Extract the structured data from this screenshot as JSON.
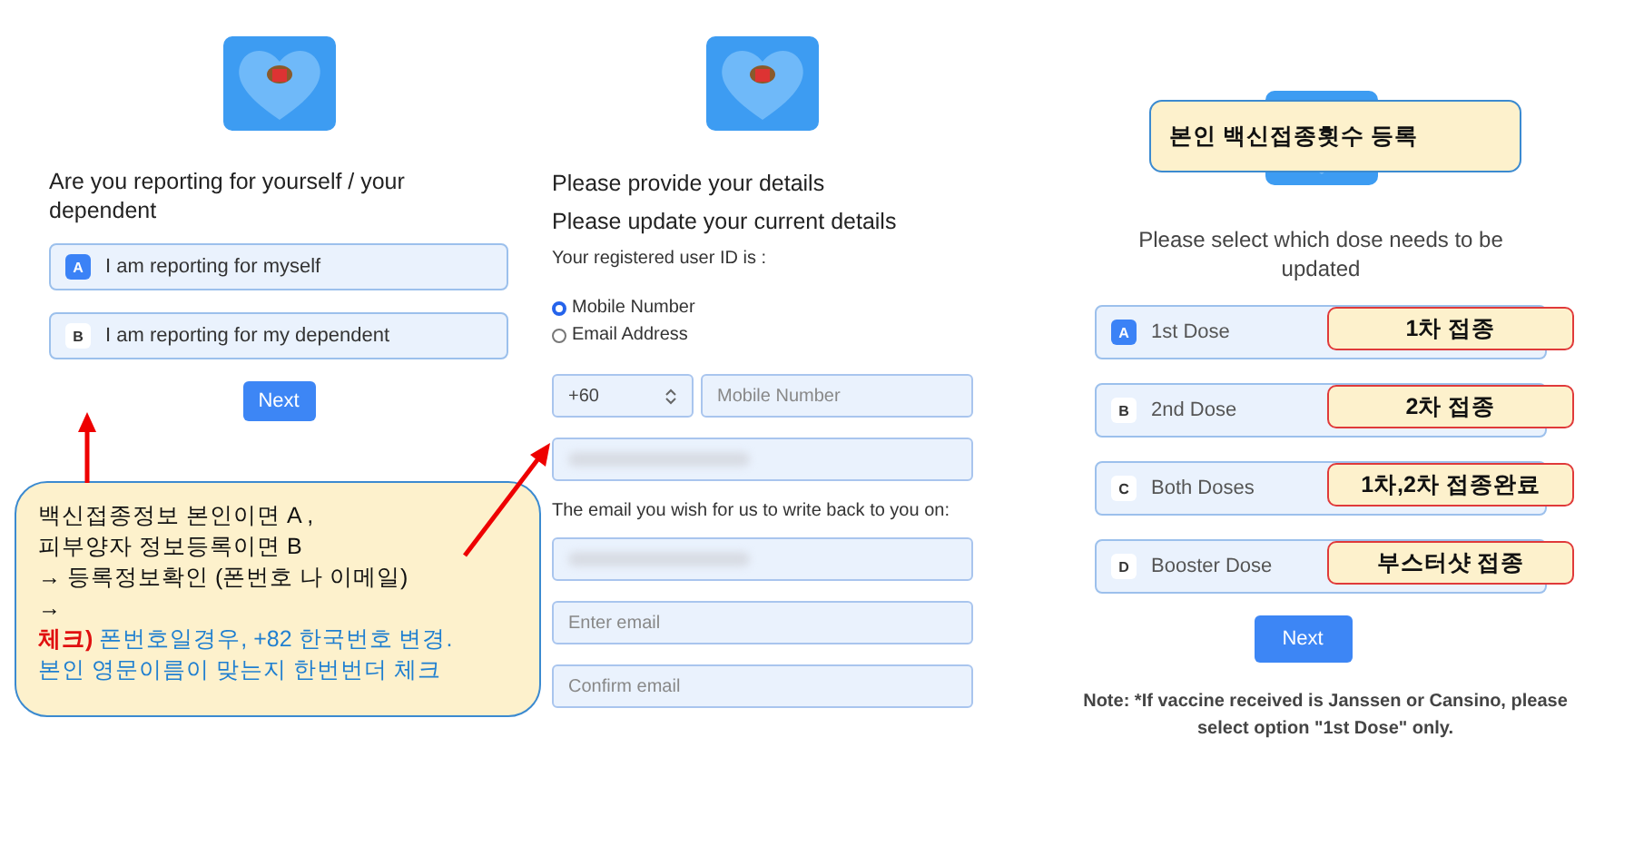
{
  "screen_1": {
    "title": "Are you reporting for yourself / your dependent",
    "options": [
      {
        "letter": "A",
        "label": "I am reporting for myself",
        "selected": true
      },
      {
        "letter": "B",
        "label": "I am reporting for my dependent",
        "selected": false
      }
    ],
    "button": "Next"
  },
  "screen_2": {
    "heading": "Please provide your details",
    "subheading": "Please update your current details",
    "id_label": "Your registered user ID is :",
    "radios": [
      {
        "label": "Mobile Number",
        "selected": true
      },
      {
        "label": "Email Address",
        "selected": false
      }
    ],
    "country_code": "+60",
    "mobile_placeholder": "Mobile Number",
    "email_label": "The email you wish for us to write back to you on:",
    "email_placeholder": "Enter email",
    "confirm_placeholder": "Confirm email"
  },
  "screen_3": {
    "title": "Please select which dose needs to be updated",
    "options": [
      {
        "letter": "A",
        "label": "1st Dose",
        "selected": true,
        "annotation": "1차 접종"
      },
      {
        "letter": "B",
        "label": "2nd Dose",
        "selected": false,
        "annotation": "2차 접종"
      },
      {
        "letter": "C",
        "label": "Both Doses",
        "selected": false,
        "annotation": "1차,2차 접종완료"
      },
      {
        "letter": "D",
        "label": "Booster Dose",
        "selected": false,
        "annotation": "부스터샷 접종"
      }
    ],
    "button": "Next",
    "note": "Note: *If vaccine received is Janssen or Cansino, please select option \"1st Dose\" only."
  },
  "callout_title": "본인 백신접종횟수 등록",
  "callout_lines": [
    {
      "kind": "plain",
      "text": "백신접종정보 본인이면 A ,"
    },
    {
      "kind": "plain",
      "text": "피부양자 정보등록이면 B"
    },
    {
      "kind": "plain",
      "text": "→  등록정보확인 (폰번호 나 이메일)"
    },
    {
      "kind": "plain",
      "text": "→"
    },
    {
      "kind": "check",
      "lead": "체크)",
      "text": "폰번호일경우, +82 한국번호 변경."
    },
    {
      "kind": "blue",
      "text": "본인 영문이름이 맞는지 한번번더 체크"
    }
  ]
}
